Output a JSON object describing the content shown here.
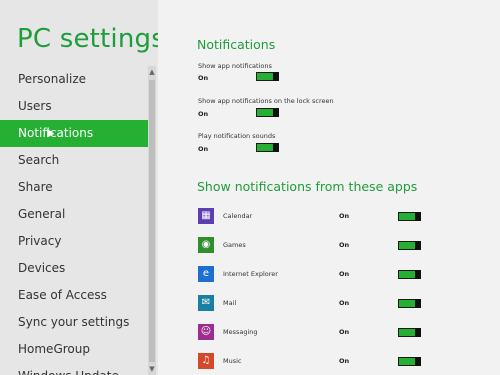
{
  "nav": {
    "title": "PC settings",
    "items": [
      {
        "label": "Personalize"
      },
      {
        "label": "Users"
      },
      {
        "label": "Notifications"
      },
      {
        "label": "Search"
      },
      {
        "label": "Share"
      },
      {
        "label": "General"
      },
      {
        "label": "Privacy"
      },
      {
        "label": "Devices"
      },
      {
        "label": "Ease of Access"
      },
      {
        "label": "Sync your settings"
      },
      {
        "label": "HomeGroup"
      },
      {
        "label": "Windows Update"
      }
    ],
    "selected_index": 2
  },
  "notifications": {
    "title": "Notifications",
    "settings": [
      {
        "label": "Show app notifications",
        "state": "On",
        "on": true
      },
      {
        "label": "Show app notifications on the lock screen",
        "state": "On",
        "on": true
      },
      {
        "label": "Play notification sounds",
        "state": "On",
        "on": true
      }
    ]
  },
  "apps": {
    "title": "Show notifications from these apps",
    "items": [
      {
        "name": "Calendar",
        "state": "On",
        "on": true,
        "icon": "calendar-icon",
        "color": "#5b3fb0"
      },
      {
        "name": "Games",
        "state": "On",
        "on": true,
        "icon": "gamepad-icon",
        "color": "#2f8f2f"
      },
      {
        "name": "Internet Explorer",
        "state": "On",
        "on": true,
        "icon": "ie-icon",
        "color": "#1e6fd0"
      },
      {
        "name": "Mail",
        "state": "On",
        "on": true,
        "icon": "mail-icon",
        "color": "#1b7fa3"
      },
      {
        "name": "Messaging",
        "state": "On",
        "on": true,
        "icon": "messaging-icon",
        "color": "#9b2e8f"
      },
      {
        "name": "Music",
        "state": "On",
        "on": true,
        "icon": "headphones-icon",
        "color": "#d24a2a"
      }
    ]
  },
  "colors": {
    "accent": "#25b033",
    "title_green": "#1f9d3a"
  }
}
